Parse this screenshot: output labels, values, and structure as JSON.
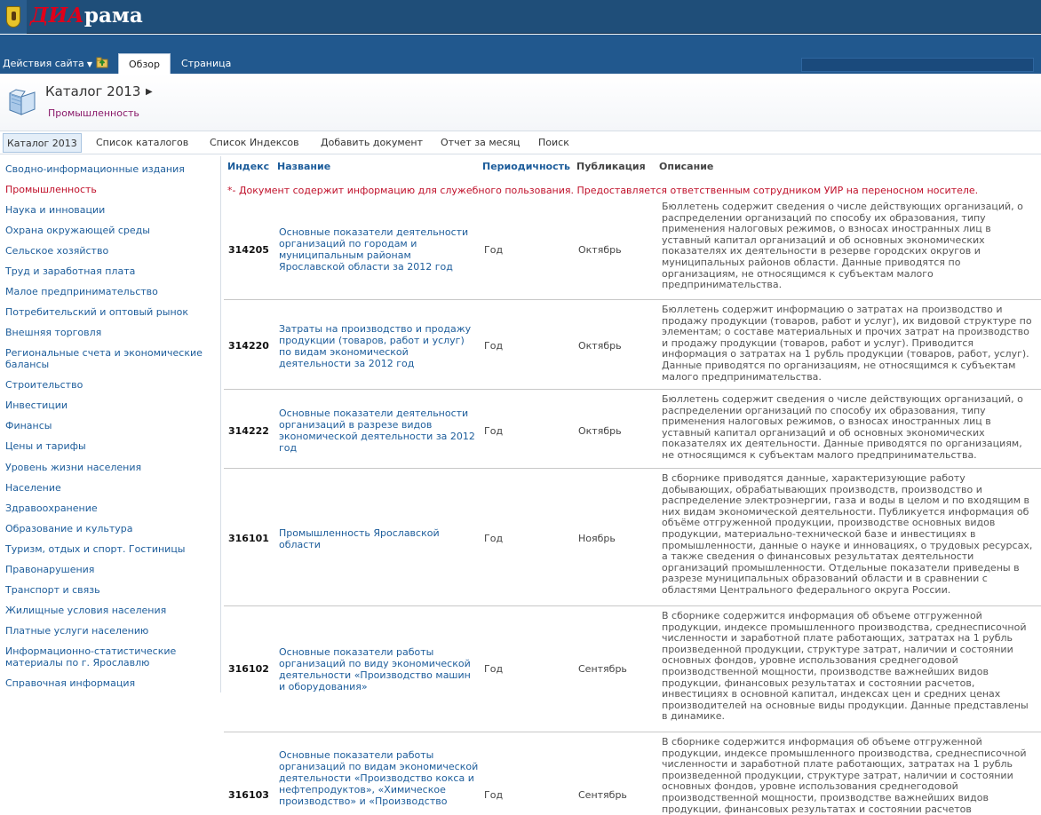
{
  "site": {
    "logo_red": "ДИА",
    "logo_white": "рама"
  },
  "ribbon": {
    "site_actions": "Действия сайта",
    "tabs": [
      {
        "label": "Обзор",
        "active": true
      },
      {
        "label": "Страница",
        "active": false
      }
    ]
  },
  "header": {
    "title": "Каталог 2013",
    "subtitle": "Промышленность"
  },
  "topnav": [
    {
      "label": "Каталог 2013",
      "active": true
    },
    {
      "label": "Список каталогов",
      "active": false
    },
    {
      "label": "Список Индексов",
      "active": false
    },
    {
      "label": "Добавить документ",
      "active": false
    },
    {
      "label": "Отчет за месяц",
      "active": false
    },
    {
      "label": "Поиск",
      "active": false
    }
  ],
  "leftnav": [
    {
      "label": "Сводно-информационные издания",
      "selected": false
    },
    {
      "label": "Промышленность",
      "selected": true
    },
    {
      "label": "Наука и инновации",
      "selected": false
    },
    {
      "label": "Охрана окружающей среды",
      "selected": false
    },
    {
      "label": "Сельское хозяйство",
      "selected": false
    },
    {
      "label": "Труд и заработная плата",
      "selected": false
    },
    {
      "label": "Малое предпринимательство",
      "selected": false
    },
    {
      "label": "Потребительский и оптовый рынок",
      "selected": false
    },
    {
      "label": "Внешняя торговля",
      "selected": false
    },
    {
      "label": "Региональные счета и экономические балансы",
      "selected": false
    },
    {
      "label": "Строительство",
      "selected": false
    },
    {
      "label": "Инвестиции",
      "selected": false
    },
    {
      "label": "Финансы",
      "selected": false
    },
    {
      "label": "Цены и тарифы",
      "selected": false
    },
    {
      "label": "Уровень жизни населения",
      "selected": false
    },
    {
      "label": "Население",
      "selected": false
    },
    {
      "label": "Здравоохранение",
      "selected": false
    },
    {
      "label": "Образование и культура",
      "selected": false
    },
    {
      "label": "Туризм, отдых и спорт. Гостиницы",
      "selected": false
    },
    {
      "label": "Правонарушения",
      "selected": false
    },
    {
      "label": "Транспорт и связь",
      "selected": false
    },
    {
      "label": "Жилищные условия населения",
      "selected": false
    },
    {
      "label": "Платные услуги населению",
      "selected": false
    },
    {
      "label": "Информационно-статистические материалы по г. Ярославлю",
      "selected": false
    },
    {
      "label": "Справочная информация",
      "selected": false
    }
  ],
  "table": {
    "headers": {
      "index": "Индекс",
      "name": "Название",
      "period": "Периодичность",
      "publication": "Публикация",
      "description": "Описание"
    },
    "notice": "*- Документ содержит информацию для служебного пользования. Предоставляется ответственным сотрудником УИР на переносном носителе.",
    "rows": [
      {
        "index": "314205",
        "title": "Основные показатели деятельности организаций по городам и муниципальным районам Ярославской области за 2012 год",
        "period": "Год",
        "publication": "Октябрь",
        "description": "Бюллетень содержит сведения о числе действующих организаций, о распределении организаций по способу их образования, типу применения налоговых режимов, о взносах иностранных лиц в уставный капитал организаций и об основных экономических показателях их деятельности в резерве городских округов и муниципальных районов области. Данные приводятся по организациям, не относящимся к субъектам малого предпринимательства."
      },
      {
        "index": "314220",
        "title": "Затраты на производство и продажу продукции (товаров, работ и услуг) по видам экономической деятельности за 2012 год",
        "period": "Год",
        "publication": "Октябрь",
        "description": "Бюллетень содержит информацию о затратах на производство и продажу продукции (товаров, работ и услуг), их видовой структуре по элементам; о составе материальных и прочих затрат на производство и продажу продукции (товаров, работ и услуг). Приводится информация о затратах на 1 рубль продукции (товаров, работ, услуг). Данные приводятся по организациям, не относящимся к субъектам малого предпринимательства."
      },
      {
        "index": "314222",
        "title": "Основные показатели деятельности организаций в разрезе видов экономической деятельности за 2012 год",
        "period": "Год",
        "publication": "Октябрь",
        "description": "Бюллетень содержит сведения о числе действующих организаций, о распределении организаций по способу их образования, типу применения налоговых режимов, о взносах иностранных лиц в уставный капитал организаций и об основных экономических показателях их деятельности. Данные приводятся по организациям, не относящимся к субъектам малого предпринимательства."
      },
      {
        "index": "316101",
        "title": "Промышленность Ярославской области",
        "period": "Год",
        "publication": "Ноябрь",
        "description": "В сборнике приводятся данные, характеризующие работу добывающих, обрабатывающих производств, производство и распределение электроэнергии, газа и воды в целом и по входящим в них видам экономической деятельности. Публикуется информация об объёме отгруженной продукции, производстве основных видов продукции, материально-технической базе и инвестициях в промышленности, данные о науке и инновациях, о трудовых ресурсах, а также сведения о финансовых результатах деятельности организаций промышленности. Отдельные показатели приведены в разрезе муниципальных образований области и в сравнении с областями Центрального федерального округа России."
      },
      {
        "index": "316102",
        "title": "Основные показатели работы организаций по виду экономической деятельности «Производство машин и оборудования»",
        "period": "Год",
        "publication": "Сентябрь",
        "description": "В сборнике содержится информация об объеме отгруженной продукции, индексе промышленного производства, среднесписочной численности и заработной плате работающих, затратах на 1 рубль произведенной продукции, структуре затрат, наличии и состоянии основных фондов, уровне использования среднегодовой производственной мощности, производстве важнейших видов продукции, финансовых результатах и состоянии расчетов, инвестициях в основной капитал, индексах цен и средних ценах производителей на основные виды продукции. Данные представлены в динамике."
      },
      {
        "index": "316103",
        "title": "Основные показатели работы организаций по видам экономической деятельности «Производство кокса и нефтепродуктов», «Химическое производство» и «Производство",
        "period": "Год",
        "publication": "Сентябрь",
        "description": "В сборнике содержится информация об объеме отгруженной продукции, индексе промышленного производства, среднесписочной численности и заработной плате работающих, затратах на 1 рубль произведенной продукции, структуре затрат, наличии и состоянии основных фондов, уровне использования среднегодовой производственной мощности, производстве важнейших видов продукции, финансовых результатах и состоянии расчетов"
      }
    ]
  }
}
